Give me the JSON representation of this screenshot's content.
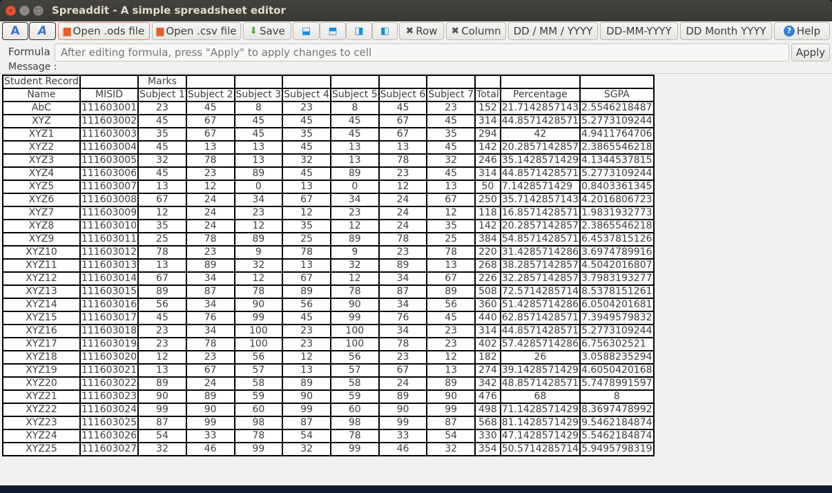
{
  "window": {
    "title": "Spreaddit - A simple spreadsheet editor"
  },
  "toolbar": {
    "bold_icon": "A",
    "italic_icon": "A",
    "open_ods": "Open .ods file",
    "open_csv": "Open .csv file",
    "save": "Save",
    "del_row": "Row",
    "del_col": "Column",
    "date1": "DD / MM / YYYY",
    "date2": "DD-MM-YYYY",
    "date3": "DD Month YYYY",
    "help": "Help"
  },
  "formula": {
    "label": "Formula",
    "placeholder": "After editing formula, press \"Apply\" to apply changes to cell",
    "value": "",
    "apply": "Apply"
  },
  "message": {
    "label": "Message :",
    "text": ""
  },
  "sheet": {
    "row0": [
      "Student Record",
      "",
      "Marks",
      "",
      "",
      "",
      "",
      "",
      "",
      "",
      ""
    ],
    "headers": [
      "Name",
      "MISID",
      "Subject 1",
      "Subject 2",
      "Subject 3",
      "Subject 4",
      "Subject 5",
      "Subject 6",
      "Subject 7",
      "Total",
      "Percentage",
      "SGPA"
    ],
    "rows": [
      [
        "AbC",
        "111603001",
        "23",
        "45",
        "8",
        "23",
        "8",
        "45",
        "23",
        "152",
        "21.7142857143",
        "2.5546218487"
      ],
      [
        "XYZ",
        "111603002",
        "45",
        "67",
        "45",
        "45",
        "45",
        "67",
        "45",
        "314",
        "44.8571428571",
        "5.2773109244"
      ],
      [
        "XYZ1",
        "111603003",
        "35",
        "67",
        "45",
        "35",
        "45",
        "67",
        "35",
        "294",
        "42",
        "4.9411764706"
      ],
      [
        "XYZ2",
        "111603004",
        "45",
        "13",
        "13",
        "45",
        "13",
        "13",
        "45",
        "142",
        "20.2857142857",
        "2.3865546218"
      ],
      [
        "XYZ3",
        "111603005",
        "32",
        "78",
        "13",
        "32",
        "13",
        "78",
        "32",
        "246",
        "35.1428571429",
        "4.1344537815"
      ],
      [
        "XYZ4",
        "111603006",
        "45",
        "23",
        "89",
        "45",
        "89",
        "23",
        "45",
        "314",
        "44.8571428571",
        "5.2773109244"
      ],
      [
        "XYZ5",
        "111603007",
        "13",
        "12",
        "0",
        "13",
        "0",
        "12",
        "13",
        "50",
        "7.1428571429",
        "0.8403361345"
      ],
      [
        "XYZ6",
        "111603008",
        "67",
        "24",
        "34",
        "67",
        "34",
        "24",
        "67",
        "250",
        "35.7142857143",
        "4.2016806723"
      ],
      [
        "XYZ7",
        "111603009",
        "12",
        "24",
        "23",
        "12",
        "23",
        "24",
        "12",
        "118",
        "16.8571428571",
        "1.9831932773"
      ],
      [
        "XYZ8",
        "111603010",
        "35",
        "24",
        "12",
        "35",
        "12",
        "24",
        "35",
        "142",
        "20.2857142857",
        "2.3865546218"
      ],
      [
        "XYZ9",
        "111603011",
        "25",
        "78",
        "89",
        "25",
        "89",
        "78",
        "25",
        "384",
        "54.8571428571",
        "6.4537815126"
      ],
      [
        "XYZ10",
        "111603012",
        "78",
        "23",
        "9",
        "78",
        "9",
        "23",
        "78",
        "220",
        "31.4285714286",
        "3.6974789916"
      ],
      [
        "XYZ11",
        "111603013",
        "13",
        "89",
        "32",
        "13",
        "32",
        "89",
        "13",
        "268",
        "38.2857142857",
        "4.5042016807"
      ],
      [
        "XYZ12",
        "111603014",
        "67",
        "34",
        "12",
        "67",
        "12",
        "34",
        "67",
        "226",
        "32.2857142857",
        "3.7983193277"
      ],
      [
        "XYZ13",
        "111603015",
        "89",
        "87",
        "78",
        "89",
        "78",
        "87",
        "89",
        "508",
        "72.5714285714",
        "8.5378151261"
      ],
      [
        "XYZ14",
        "111603016",
        "56",
        "34",
        "90",
        "56",
        "90",
        "34",
        "56",
        "360",
        "51.4285714286",
        "6.0504201681"
      ],
      [
        "XYZ15",
        "111603017",
        "45",
        "76",
        "99",
        "45",
        "99",
        "76",
        "45",
        "440",
        "62.8571428571",
        "7.3949579832"
      ],
      [
        "XYZ16",
        "111603018",
        "23",
        "34",
        "100",
        "23",
        "100",
        "34",
        "23",
        "314",
        "44.8571428571",
        "5.2773109244"
      ],
      [
        "XYZ17",
        "111603019",
        "23",
        "78",
        "100",
        "23",
        "100",
        "78",
        "23",
        "402",
        "57.4285714286",
        "6.756302521"
      ],
      [
        "XYZ18",
        "111603020",
        "12",
        "23",
        "56",
        "12",
        "56",
        "23",
        "12",
        "182",
        "26",
        "3.0588235294"
      ],
      [
        "XYZ19",
        "111603021",
        "13",
        "67",
        "57",
        "13",
        "57",
        "67",
        "13",
        "274",
        "39.1428571429",
        "4.6050420168"
      ],
      [
        "XYZ20",
        "111603022",
        "89",
        "24",
        "58",
        "89",
        "58",
        "24",
        "89",
        "342",
        "48.8571428571",
        "5.7478991597"
      ],
      [
        "XYZ21",
        "111603023",
        "90",
        "89",
        "59",
        "90",
        "59",
        "89",
        "90",
        "476",
        "68",
        "8"
      ],
      [
        "XYZ22",
        "111603024",
        "99",
        "90",
        "60",
        "99",
        "60",
        "90",
        "99",
        "498",
        "71.1428571429",
        "8.3697478992"
      ],
      [
        "XYZ23",
        "111603025",
        "87",
        "99",
        "98",
        "87",
        "98",
        "99",
        "87",
        "568",
        "81.1428571429",
        "9.5462184874"
      ],
      [
        "XYZ24",
        "111603026",
        "54",
        "33",
        "78",
        "54",
        "78",
        "33",
        "54",
        "330",
        "47.1428571429",
        "5.5462184874"
      ],
      [
        "XYZ25",
        "111603027",
        "32",
        "46",
        "99",
        "32",
        "99",
        "46",
        "32",
        "354",
        "50.5714285714",
        "5.9495798319"
      ]
    ]
  }
}
